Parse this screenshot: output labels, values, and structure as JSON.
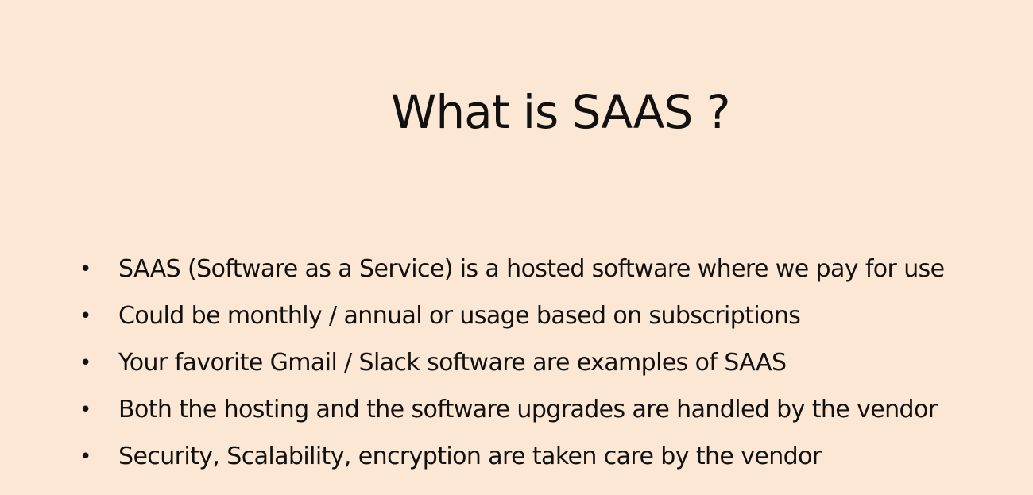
{
  "slide": {
    "title": "What is SAAS ?",
    "bullet_marker": "•",
    "bullets": [
      "SAAS (Software as a Service) is a hosted software where we pay for use",
      "Could be monthly / annual or usage based on subscriptions",
      "Your favorite Gmail / Slack software are examples of SAAS",
      "Both the hosting and the  software upgrades are handled by the vendor",
      "Security, Scalability, encryption  are taken care by the vendor"
    ]
  },
  "colors": {
    "background": "#fbe7d3",
    "text": "#111111"
  }
}
